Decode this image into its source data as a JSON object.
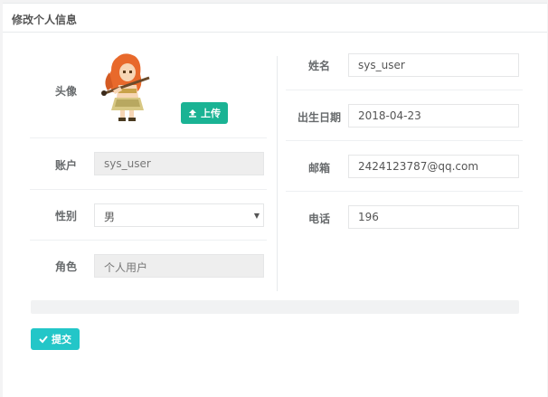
{
  "panel": {
    "title": "修改个人信息"
  },
  "left": {
    "avatar_label": "头像",
    "upload_label": "上传",
    "account_label": "账户",
    "account_value": "sys_user",
    "gender_label": "性别",
    "gender_value": "男",
    "role_label": "角色",
    "role_value": "个人用户"
  },
  "right": {
    "name_label": "姓名",
    "name_value": "sys_user",
    "birth_label": "出生日期",
    "birth_value": "2018-04-23",
    "email_label": "邮箱",
    "email_value": "2424123787@qq.com",
    "phone_label": "电话",
    "phone_value": "196"
  },
  "footer": {
    "submit_label": "提交"
  },
  "icons": {
    "upload": "upload-icon",
    "submit": "check-icon",
    "select_caret": "caret-down-icon",
    "avatar": "avatar-image"
  },
  "colors": {
    "upload_button": "#1ab394",
    "submit_button": "#23c6c8",
    "readonly_bg": "#eeeeee"
  }
}
